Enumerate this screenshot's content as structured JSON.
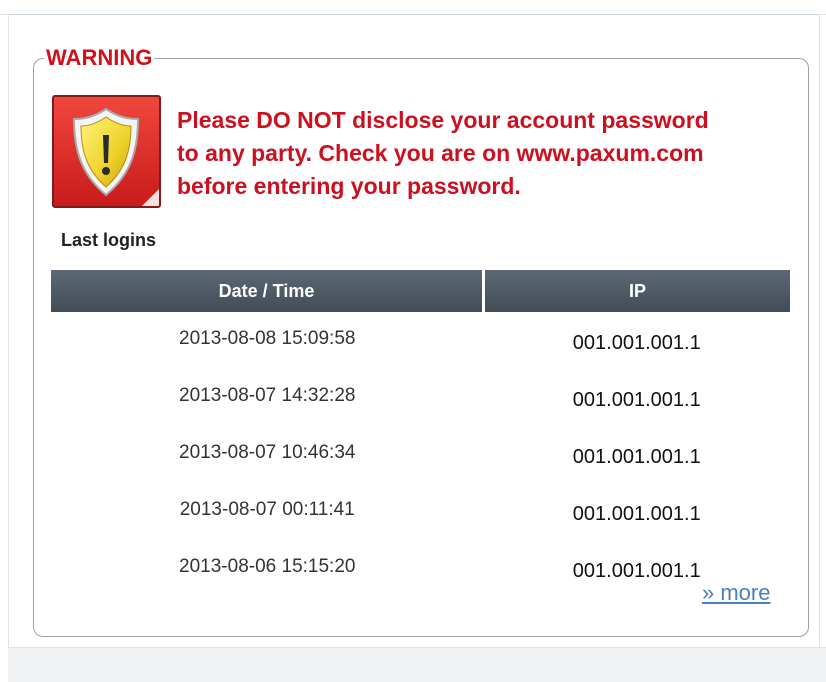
{
  "warning": {
    "legend": "WARNING",
    "lines": [
      "Please DO NOT disclose your account password",
      "to any party. Check you are on www.paxum.com",
      "before entering your password."
    ],
    "icon": "shield-warning-icon",
    "colors": {
      "text": "#cc1020",
      "icon_bg": "#e02a2a",
      "shield": "#f2e22a"
    }
  },
  "last_logins": {
    "title": "Last logins",
    "columns": [
      "Date / Time",
      "IP"
    ],
    "rows": [
      {
        "datetime": "2013-08-08 15:09:58",
        "ip": "001.001.001.1"
      },
      {
        "datetime": "2013-08-07 14:32:28",
        "ip": "001.001.001.1"
      },
      {
        "datetime": "2013-08-07 10:46:34",
        "ip": "001.001.001.1"
      },
      {
        "datetime": "2013-08-07 00:11:41",
        "ip": "001.001.001.1"
      },
      {
        "datetime": "2013-08-06 15:15:20",
        "ip": "001.001.001.1"
      }
    ],
    "more_link": "» more",
    "header_color": "#4e5a65"
  }
}
